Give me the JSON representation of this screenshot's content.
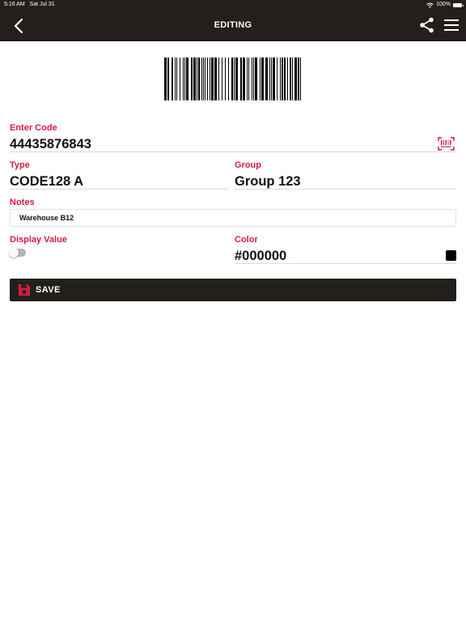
{
  "status_bar": {
    "time": "5:16 AM",
    "date": "Sat Jul 31",
    "battery": "100%",
    "wifi_icon": "wifi-icon",
    "battery_icon": "battery-icon"
  },
  "nav": {
    "title": "EDITING",
    "back_icon": "chevron-left-icon",
    "share_icon": "share-icon",
    "menu_icon": "hamburger-menu-icon"
  },
  "colors": {
    "accent": "#d41c3f",
    "bar": "#231f1c",
    "swatch": "#000000"
  },
  "form": {
    "code_label": "Enter Code",
    "code_value": "44435876843",
    "type_label": "Type",
    "type_value": "CODE128 A",
    "group_label": "Group",
    "group_value": "Group 123",
    "notes_label": "Notes",
    "notes_value": "Warehouse B12",
    "display_value_label": "Display Value",
    "display_value_on": false,
    "color_label": "Color",
    "color_value": "#000000"
  },
  "save_button": {
    "label": "SAVE",
    "icon": "floppy-disk-icon"
  }
}
